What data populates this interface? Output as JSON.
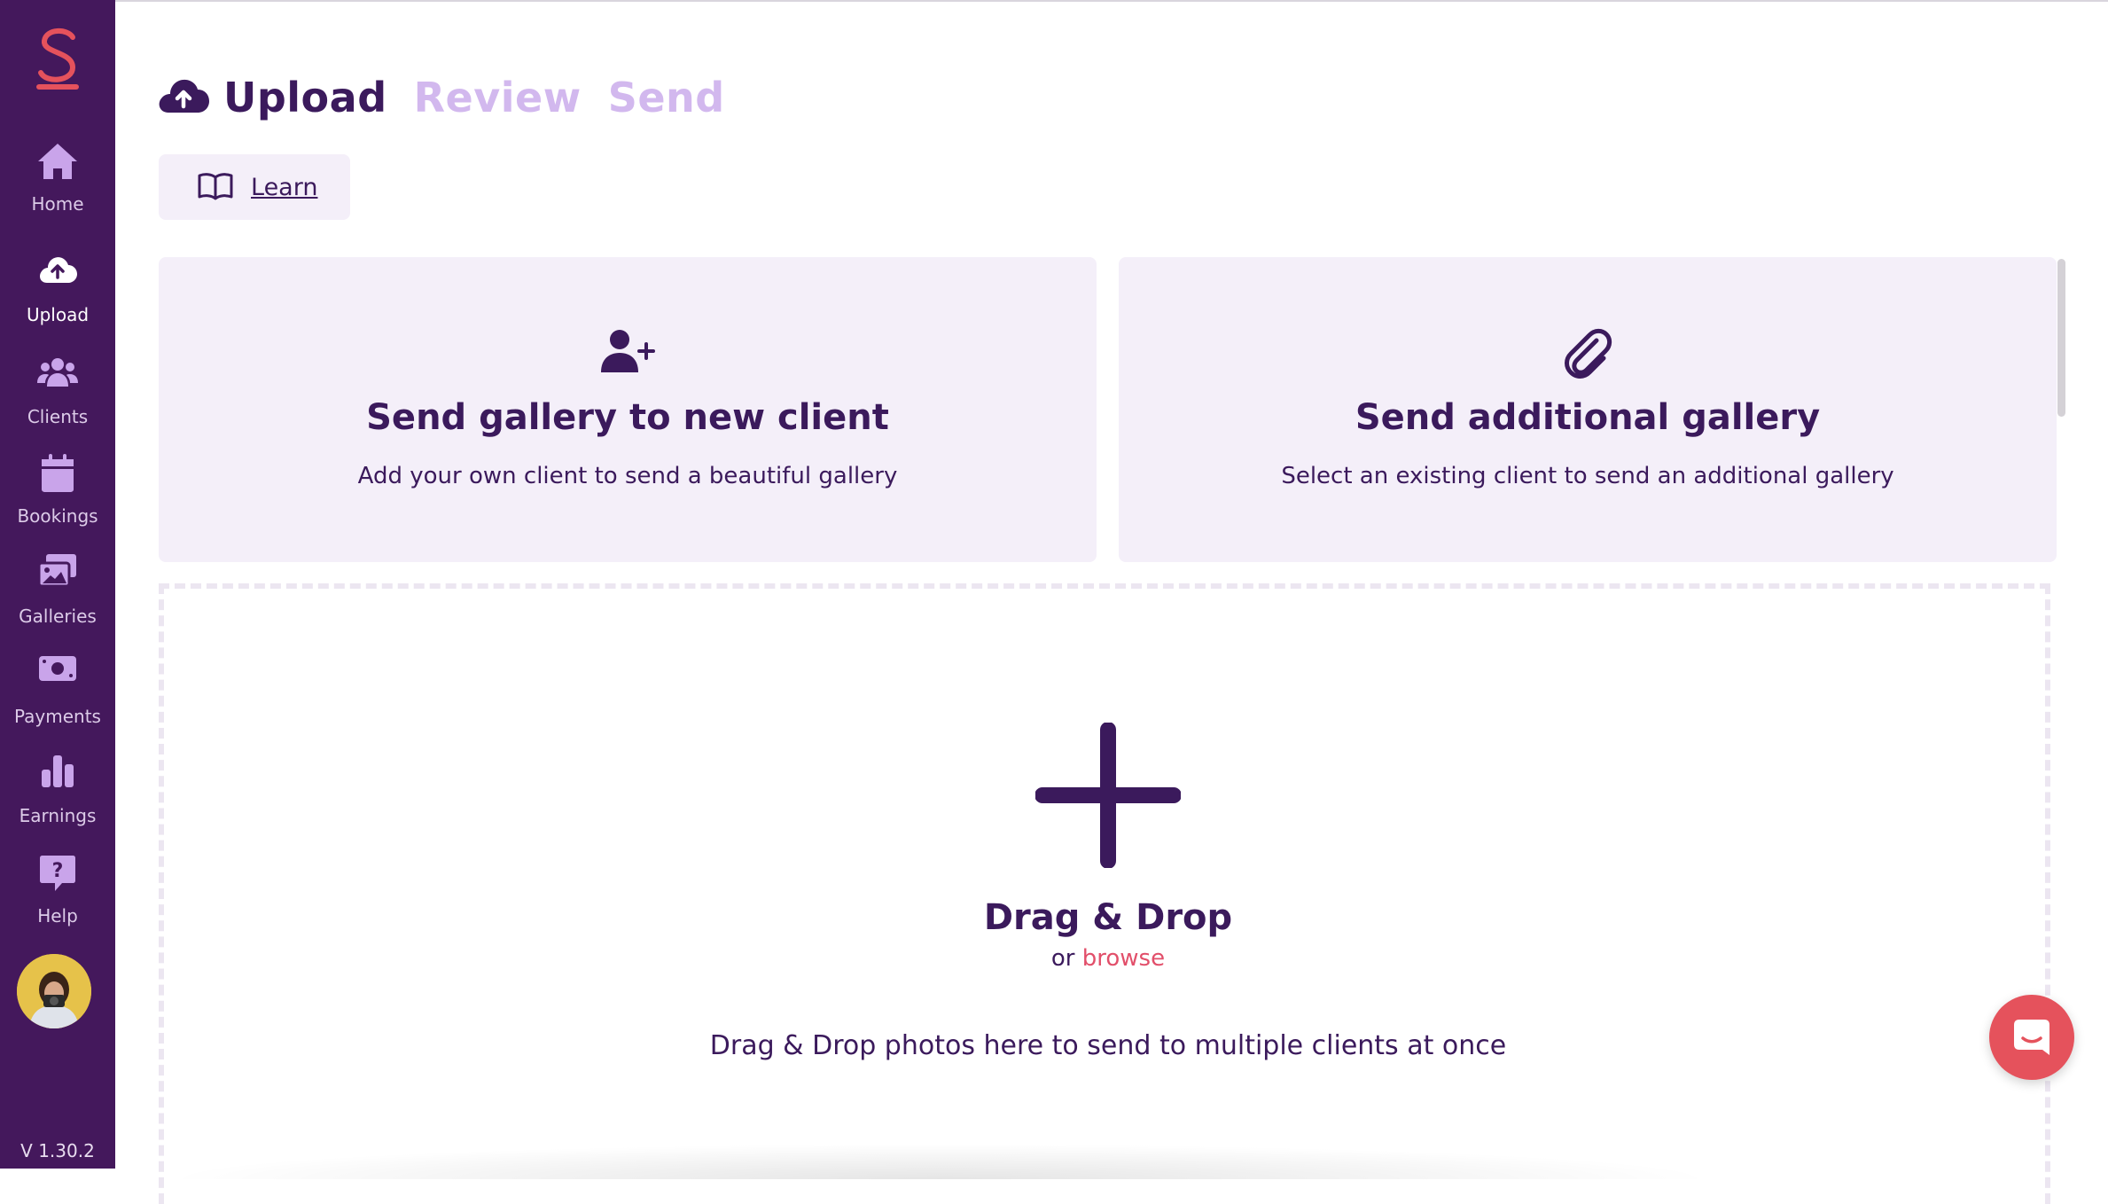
{
  "colors": {
    "sidebar_bg": "#44185c",
    "primary_text": "#3b1a5c",
    "step_inactive": "#d2b8ee",
    "card_bg": "#f4eff9",
    "accent_link": "#e24f6a",
    "chat_button": "#e5525c",
    "logo": "#e5525c"
  },
  "sidebar": {
    "items": [
      {
        "label": "Home",
        "icon": "home-icon"
      },
      {
        "label": "Upload",
        "icon": "cloud-upload-icon"
      },
      {
        "label": "Clients",
        "icon": "users-icon"
      },
      {
        "label": "Bookings",
        "icon": "calendar-icon"
      },
      {
        "label": "Galleries",
        "icon": "images-icon"
      },
      {
        "label": "Payments",
        "icon": "money-icon"
      },
      {
        "label": "Earnings",
        "icon": "bar-chart-icon"
      },
      {
        "label": "Help",
        "icon": "help-icon"
      }
    ],
    "active": "Upload",
    "version": "V 1.30.2"
  },
  "header": {
    "steps": [
      "Upload",
      "Review",
      "Send"
    ],
    "current_step": "Upload",
    "learn_label": "Learn"
  },
  "cards": [
    {
      "title": "Send gallery to new client",
      "subtitle": "Add your own client to send a beautiful gallery",
      "icon": "user-plus-icon"
    },
    {
      "title": "Send additional gallery",
      "subtitle": "Select an existing client to send an additional gallery",
      "icon": "paperclip-icon"
    }
  ],
  "dropzone": {
    "title": "Drag & Drop",
    "or_text": "or",
    "browse_label": "browse",
    "description": "Drag & Drop photos here to send to multiple clients at once",
    "icon": "plus-icon"
  },
  "chat": {
    "icon": "chat-icon"
  }
}
